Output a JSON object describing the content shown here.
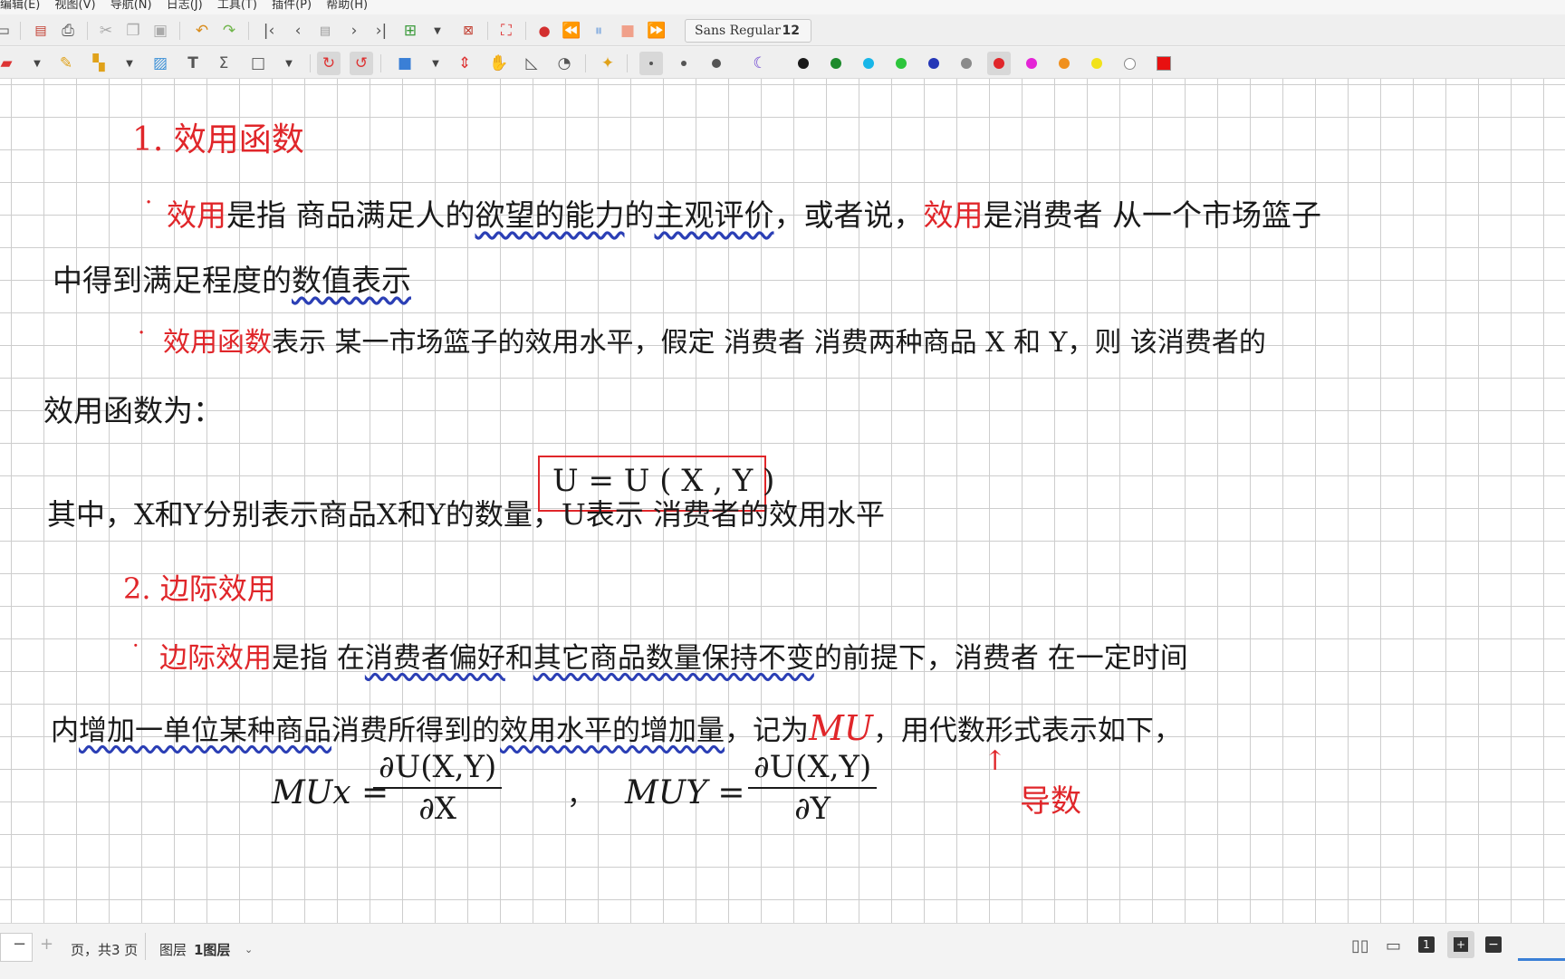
{
  "menu": [
    "编辑(E)",
    "视图(V)",
    "导航(N)",
    "日志(J)",
    "工具(T)",
    "插件(P)",
    "帮助(H)"
  ],
  "toolbar": {
    "font_name": "Sans Regular",
    "font_size": "12",
    "colors": [
      "#1a1a1a",
      "#1d8a2c",
      "#18b6e8",
      "#2dc53c",
      "#2537b7",
      "#8a8a8a",
      "#e0262a",
      "#e424d6",
      "#f0901e",
      "#f2e21a",
      "#ffffff"
    ],
    "selected_color": "#e0262a",
    "pen_color": "#e81010"
  },
  "note": {
    "heading1": "1. 效用函数",
    "bullet1_key": "效用",
    "bullet1_a": "是指 商品满足人的",
    "bullet1_b": "欲望的能力",
    "bullet1_c": "的",
    "bullet1_d": "主观评价",
    "bullet1_e": "，或者说，",
    "bullet1_key2": "效用",
    "bullet1_f": "是消费者 从一个市场篮子",
    "bullet1_line2_a": "中得到满足程度的",
    "bullet1_line2_b": "数值表示",
    "bullet2_key": "效用函数",
    "bullet2_a": "表示 某一市场篮子的效用水平，假定 消费者 消费两种商品 X 和 Y，则 该消费者的",
    "bullet2_line2": "效用函数为：",
    "formula_box": "U = U ( X , Y )",
    "explain": "其中，X和Y分别表示商品X和Y的数量，U表示 消费者的效用水平",
    "heading2": "2. 边际效用",
    "bullet3_key": "边际效用",
    "bullet3_a": "是指 在",
    "bullet3_b": "消费者偏好",
    "bullet3_c": "和",
    "bullet3_d": "其它商品数量保持不变",
    "bullet3_e": "的前提下，消费者 在一定时间",
    "bullet3_line2_a": "内",
    "bullet3_line2_b": "增加一单位某种商品",
    "bullet3_line2_c": "消费所得到的",
    "bullet3_line2_d": "效用水平的增加量",
    "bullet3_line2_e": "，记为",
    "bullet3_line2_mu": "MU",
    "bullet3_line2_f": "，用代数形式表示如下，",
    "mux_label": "MUx =",
    "mux_num": "∂U(X,Y)",
    "mux_den": "∂X",
    "comma": "，",
    "muy_label": "MUY =",
    "muy_num": "∂U(X,Y)",
    "muy_den": "∂Y",
    "arrow": "↑",
    "derivative_note": "导数"
  },
  "status": {
    "page_input": "",
    "page_text": "页，共3 页",
    "layer_label": "图层",
    "layer_value": "1图层",
    "page_count_icon": "1"
  }
}
